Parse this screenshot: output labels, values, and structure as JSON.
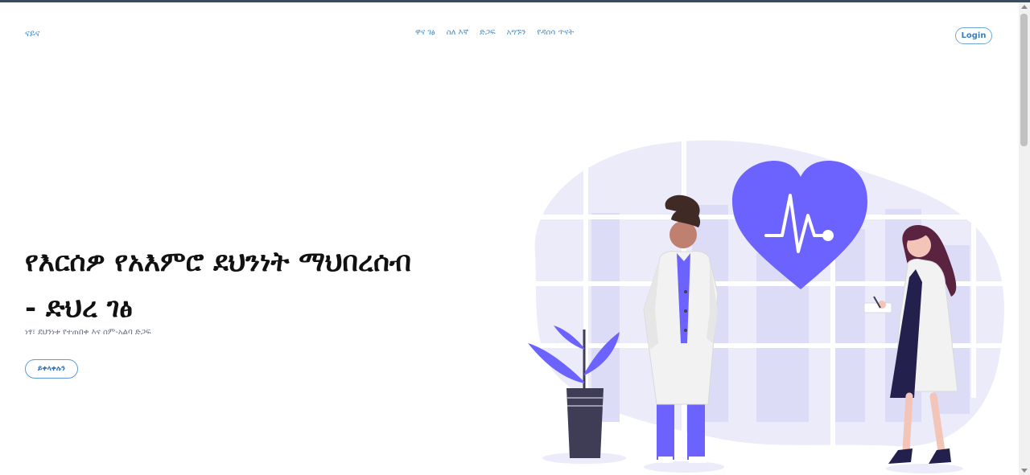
{
  "header": {
    "logo": "ናይና",
    "nav": [
      "ዋና ገፅ",
      "ስለ እኛ",
      "ድጋፍ",
      "አግኙን",
      "የዳሰሳ ጥናት"
    ],
    "login_label": "Login"
  },
  "hero": {
    "title_line1": "የእርሰዎ የአእምሮ ደህንነት ማህበረሰብ",
    "title_line2": "- ድህረ ገፅ",
    "subtitle": "ነፃ፣ ደህንነቱ የተጠበቀ እና ሰም-አልባ ድጋፍ",
    "cta_label": "ይቀላቀሉን"
  },
  "colors": {
    "accent_purple": "#6c63ff",
    "light_lavender": "#ebebfa",
    "link_blue": "#4a90c8"
  }
}
